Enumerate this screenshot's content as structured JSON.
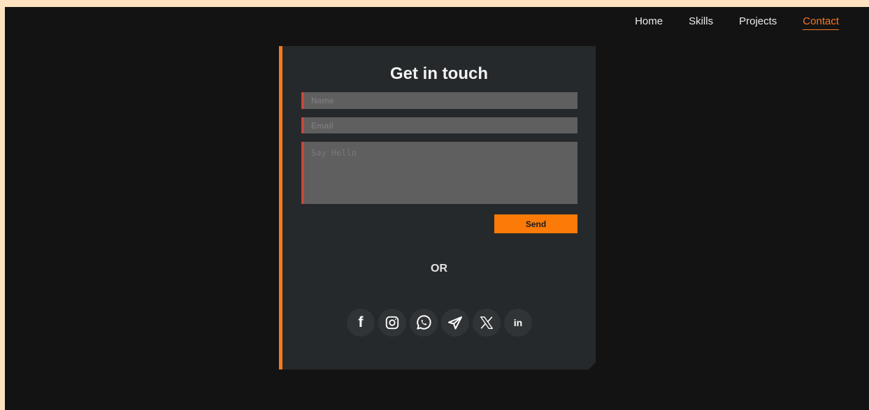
{
  "nav": {
    "items": [
      {
        "label": "Home",
        "active": false
      },
      {
        "label": "Skills",
        "active": false
      },
      {
        "label": "Projects",
        "active": false
      },
      {
        "label": "Contact",
        "active": true
      }
    ]
  },
  "contact": {
    "title": "Get in touch",
    "name_placeholder": "Name",
    "email_placeholder": "Email",
    "message_placeholder": "Say Hello",
    "send_label": "Send",
    "or_label": "OR"
  },
  "socials": {
    "facebook": {
      "icon": "facebook-icon",
      "glyph": "f"
    },
    "instagram": {
      "icon": "instagram-icon"
    },
    "whatsapp": {
      "icon": "whatsapp-icon"
    },
    "telegram": {
      "icon": "telegram-icon"
    },
    "x": {
      "icon": "x-icon"
    },
    "linkedin": {
      "icon": "linkedin-icon",
      "glyph": "in"
    }
  },
  "colors": {
    "accent": "#f57a1f",
    "button": "#fb7a08",
    "field_border": "#c84539",
    "card_bg": "#26292b",
    "page_bg": "#131313"
  }
}
